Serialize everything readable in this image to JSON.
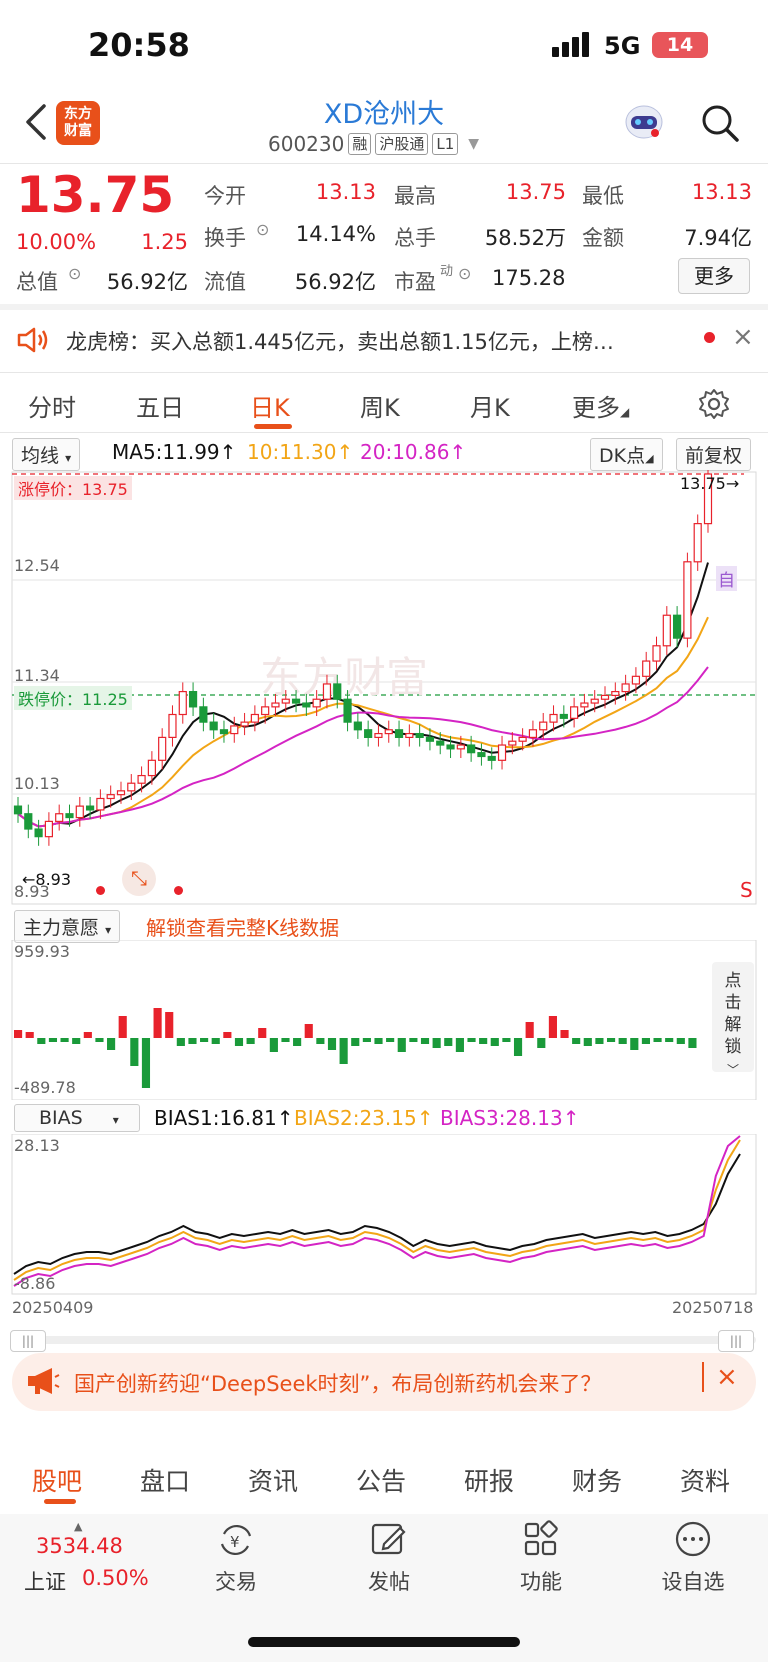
{
  "status_bar": {
    "time": "20:58",
    "network": "5G",
    "battery": "14"
  },
  "header": {
    "logo_text": "东方财富",
    "title": "XD沧州大",
    "code": "600230",
    "tags": [
      "融",
      "沪股通",
      "L1"
    ]
  },
  "quote": {
    "price": "13.75",
    "change_pct": "10.00%",
    "change": "1.25",
    "fields": [
      {
        "label": "今开",
        "value": "13.13",
        "color": "red"
      },
      {
        "label": "最高",
        "value": "13.75",
        "color": "red"
      },
      {
        "label": "最低",
        "value": "13.13",
        "color": "red"
      },
      {
        "label": "换手",
        "value": "14.14%",
        "color": "dark"
      },
      {
        "label": "总手",
        "value": "58.52万",
        "color": "dark"
      },
      {
        "label": "金额",
        "value": "7.94亿",
        "color": "dark"
      },
      {
        "label": "总值",
        "value": "56.92亿",
        "color": "dark"
      },
      {
        "label": "流值",
        "value": "56.92亿",
        "color": "dark"
      },
      {
        "label": "市盈",
        "value": "175.28",
        "color": "dark"
      }
    ],
    "pe_superscript": "动",
    "more_button": "更多"
  },
  "dragon_tiger": {
    "text": "龙虎榜：买入总额1.445亿元，卖出总额1.15亿元，上榜…"
  },
  "kline_tabs": {
    "items": [
      "分时",
      "五日",
      "日K",
      "周K",
      "月K",
      "更多"
    ],
    "active": 2
  },
  "ma_bar": {
    "dropdown": "均线",
    "ma5": "MA5:11.99↑",
    "ma10": "10:11.30↑",
    "ma20": "20:10.86↑",
    "dk_button": "DK点",
    "adjust_button": "前复权"
  },
  "main_chart": {
    "y_labels": [
      "12.54",
      "11.34",
      "10.13",
      "8.93"
    ],
    "limit_up_label": "涨停价：13.75",
    "limit_down_label": "跌停价：11.25",
    "last_price_label": "13.75",
    "min_label": "8.93",
    "watermark": "东方财富",
    "s_marker": "S",
    "self_marker": "自"
  },
  "volume_panel": {
    "dropdown": "主力意愿",
    "unlock_text": "解锁查看完整K线数据",
    "y_max": "959.93",
    "y_min": "-489.78",
    "side_button": "点击解锁"
  },
  "bias_panel": {
    "dropdown": "BIAS",
    "bias1": "BIAS1:16.81↑",
    "bias2": "BIAS2:23.15↑",
    "bias3": "BIAS3:28.13↑",
    "y_max": "28.13",
    "y_min": "-8.86",
    "date_start": "20250409",
    "date_end": "20250718"
  },
  "colors": {
    "up": "#e8222b",
    "down": "#1a9a3a",
    "ma5": "#111111",
    "ma10": "#f2a516",
    "ma20": "#d424c4",
    "accent": "#e8501a"
  },
  "ad": {
    "text": "国产创新药迎“DeepSeek时刻”，布局创新药机会来了？"
  },
  "bottom_tabs": {
    "items": [
      "股吧",
      "盘口",
      "资讯",
      "公告",
      "研报",
      "财务",
      "资料"
    ],
    "active": 0
  },
  "bottom_nav": {
    "index_value": "3534.48",
    "index_name": "上证",
    "index_change": "0.50%",
    "items": [
      {
        "label": "交易",
        "icon": "trade-icon"
      },
      {
        "label": "发帖",
        "icon": "post-icon"
      },
      {
        "label": "功能",
        "icon": "function-icon"
      },
      {
        "label": "设自选",
        "icon": "add-watchlist-icon"
      }
    ]
  }
}
